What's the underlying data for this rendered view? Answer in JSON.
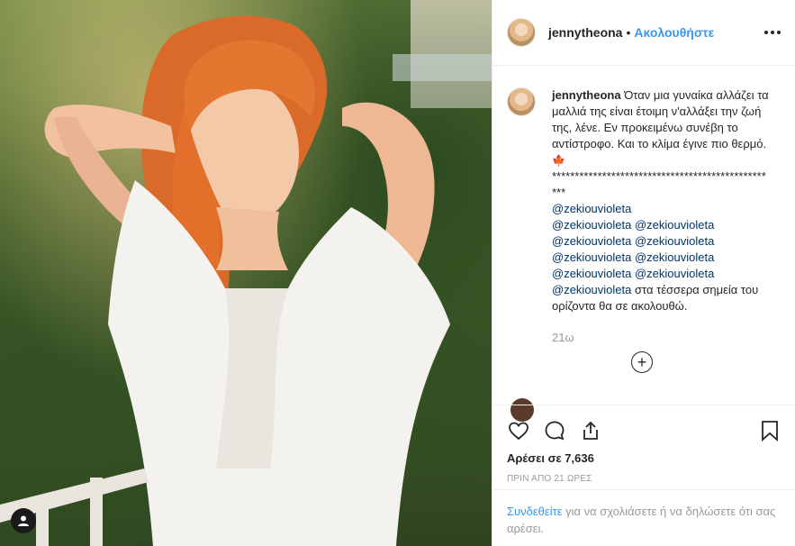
{
  "post": {
    "username": "jennytheona",
    "follow_label": "Ακολουθήστε",
    "dot": "•"
  },
  "caption": {
    "username": "jennytheona",
    "text": "Όταν μια γυναίκα αλλάζει τα μαλλιά της είναι έτοιμη ν'αλλάξει την ζωή της, λένε. Εν προκειμένω συνέβη το αντίστροφο. Και το κλίμα έγινε πιο θερμό.",
    "emoji": "🍁",
    "stars": "**************************************************",
    "mention": "@zekiouvioleta",
    "mentions_count": 11,
    "ending": "στα τέσσερα σημεία του ορίζοντα θα σε ακολουθώ."
  },
  "time_ago": "21ω",
  "likes": {
    "label": "Αρέσει σε",
    "count": "7,636"
  },
  "posted_ago": "ΠΡΙΝ ΑΠΟ 21 ΩΡΕΣ",
  "footer": {
    "login_link": "Συνδεθείτε",
    "rest": "για να σχολιάσετε ή να δηλώσετε ότι σας αρέσει."
  },
  "icons": {
    "like": "heart-icon",
    "comment": "comment-icon",
    "share": "share-icon",
    "save": "bookmark-icon",
    "more": "more-options-icon",
    "load_more": "plus-circle-icon"
  },
  "colors": {
    "accent": "#3897f0",
    "mention": "#003569",
    "muted": "#999999"
  }
}
